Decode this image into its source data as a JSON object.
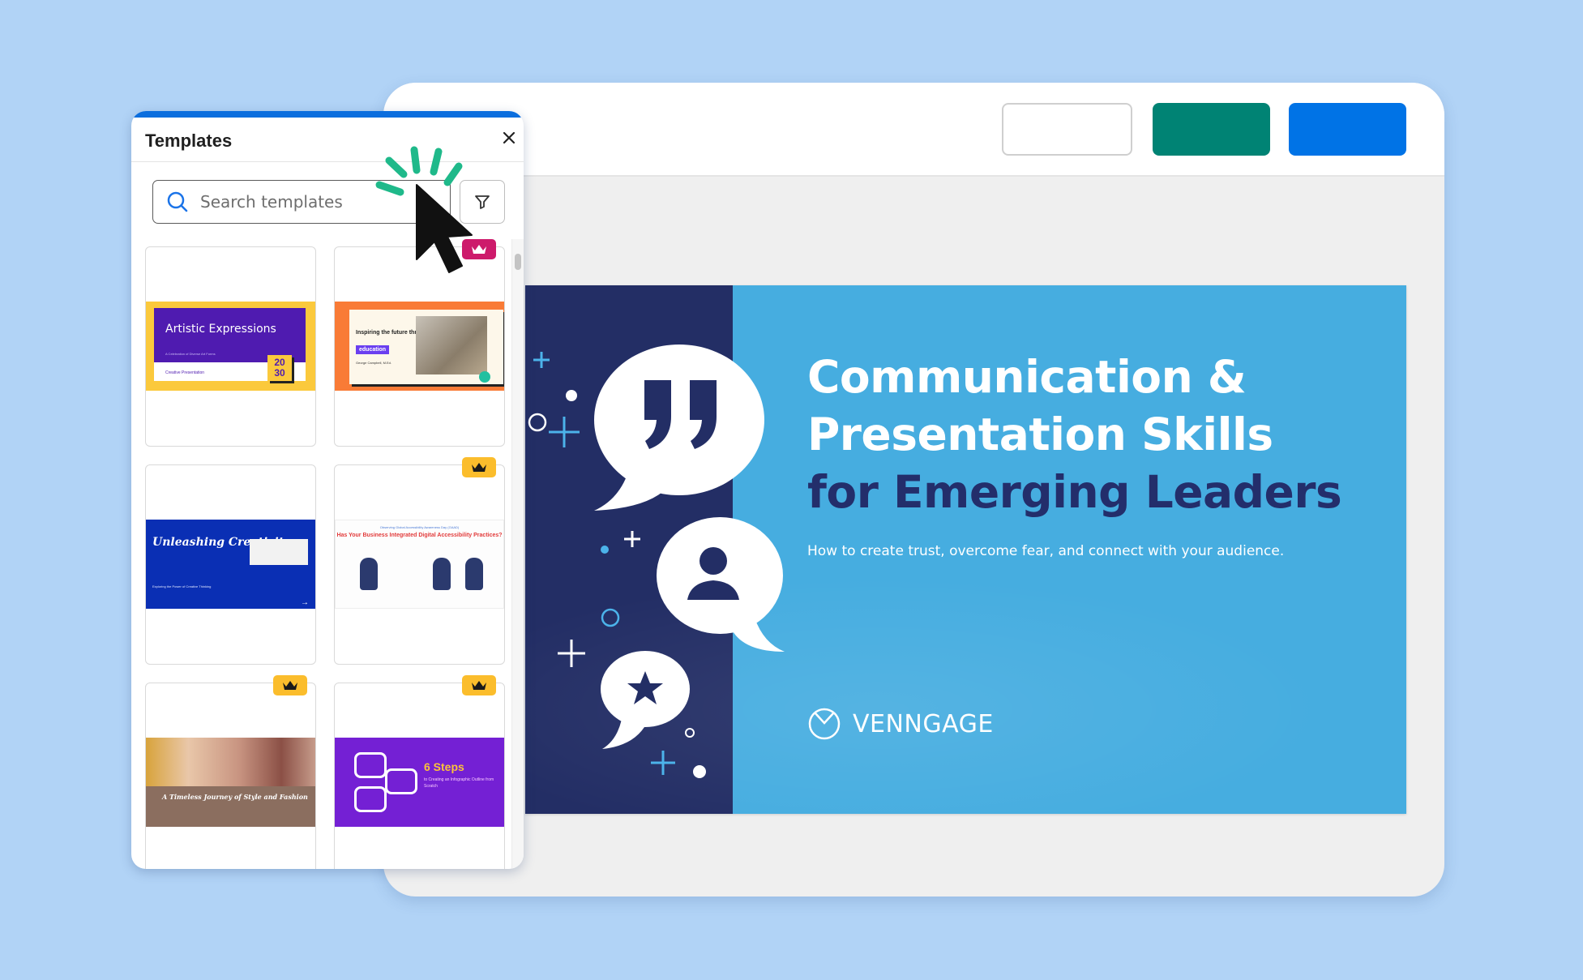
{
  "editor": {
    "header_buttons": [
      {
        "name": "outline-button",
        "label": ""
      },
      {
        "name": "teal-button",
        "label": ""
      },
      {
        "name": "blue-button",
        "label": ""
      }
    ],
    "colors": {
      "background": "#b1d3f6",
      "teal": "#008374",
      "blue": "#0073e6",
      "panel_accent": "#0b6ede"
    }
  },
  "slide": {
    "title_line1": "Communication &",
    "title_line2": "Presentation Skills",
    "title_line3": "for Emerging Leaders",
    "subtitle": "How to create trust, overcome fear, and connect with your audience.",
    "logo_text": "VENNGAGE",
    "icons": [
      "quote-bubble-icon",
      "person-bubble-icon",
      "star-bubble-icon"
    ]
  },
  "templates_panel": {
    "title": "Templates",
    "close_icon": "close-icon",
    "search": {
      "placeholder": "Search templates",
      "value": ""
    },
    "filter_icon": "filter-icon",
    "cards": [
      {
        "title": "Artistic Expressions",
        "subtitle": "A Celebration of Diverse Art Forms",
        "footer": "Creative Presentation",
        "number": "20 30",
        "premium": false
      },
      {
        "title": "Inspiring the future through",
        "highlight": "education",
        "author": "George Campbell, M.Ed.",
        "premium": true,
        "badge": "pink"
      },
      {
        "title": "Unleashing Creativity",
        "subtitle": "Exploring the Power of Creative Thinking",
        "premium": false
      },
      {
        "kicker": "Observing Global Accessibility Awareness Day (GAAD)",
        "title": "Has Your Business Integrated Digital Accessibility Practices?",
        "premium": true,
        "badge": "gold"
      },
      {
        "title": "A Timeless Journey of Style and Fashion",
        "premium": true,
        "badge": "gold"
      },
      {
        "title": "6 Steps",
        "subtitle": "to Creating an Infographic Outline from Scratch",
        "premium": true,
        "badge": "gold"
      }
    ]
  }
}
